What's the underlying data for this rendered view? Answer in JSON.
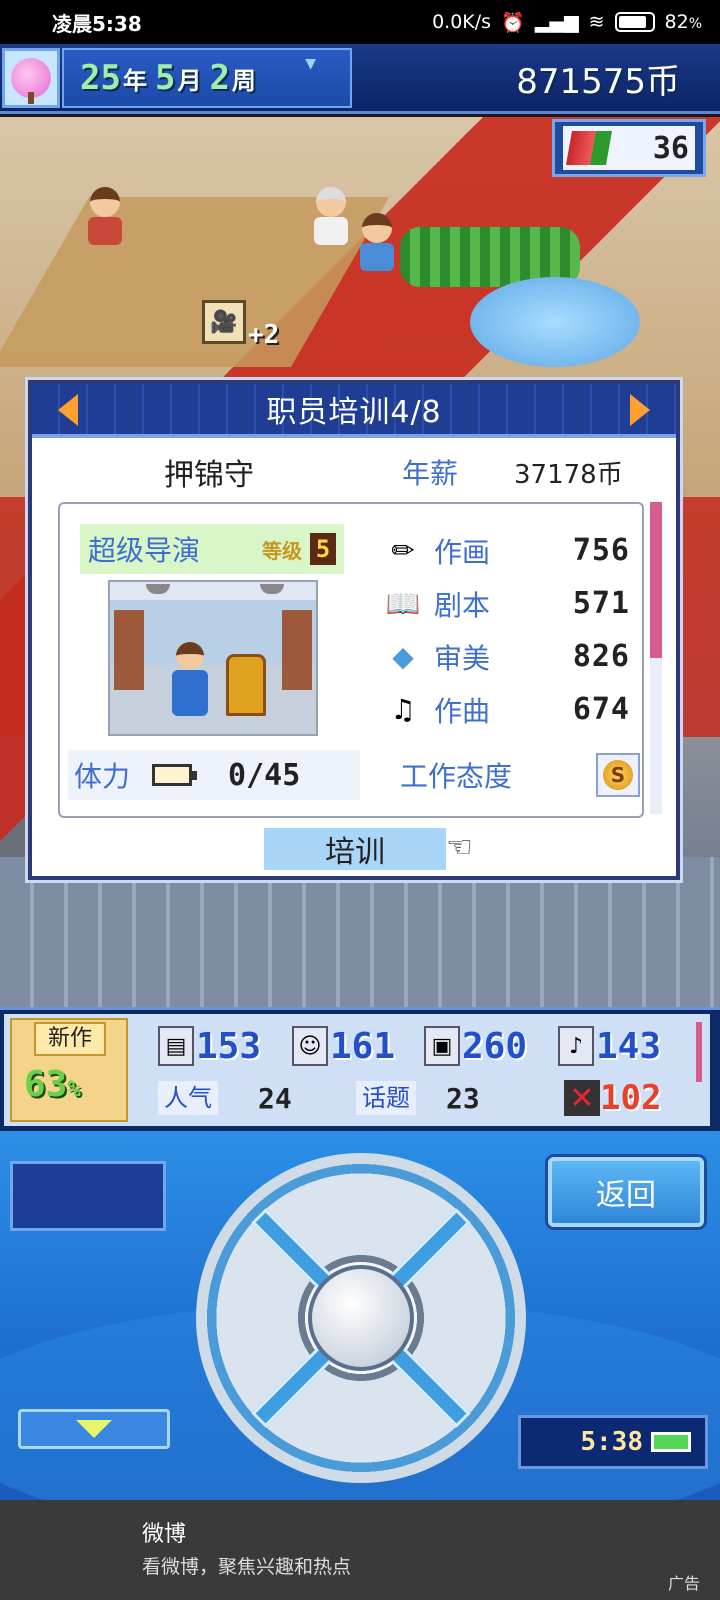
{
  "status_bar": {
    "time": "凌晨5:38",
    "network_speed": "0.0K/s",
    "battery": "82",
    "battery_unit": "%"
  },
  "top_bar": {
    "year": "25",
    "year_unit": "年",
    "month": "5",
    "month_unit": "月",
    "week": "2",
    "week_unit": "周",
    "money": "871575币",
    "fans_count": "36"
  },
  "scene": {
    "popup_gain": "+2"
  },
  "dialog": {
    "title": "职员培训4/8",
    "staff_name": "押锦守",
    "salary_label": "年薪",
    "salary_value": "37178币",
    "job": "超级导演",
    "level_label": "等级",
    "level_value": "5",
    "stamina_label": "体力",
    "stamina_value": "0/45",
    "stats": [
      {
        "icon": "pencil-icon",
        "label": "作画",
        "value": "756"
      },
      {
        "icon": "book-icon",
        "label": "剧本",
        "value": "571"
      },
      {
        "icon": "fan-icon",
        "label": "审美",
        "value": "826"
      },
      {
        "icon": "guitar-icon",
        "label": "作曲",
        "value": "674"
      }
    ],
    "attitude_label": "工作态度",
    "attitude_value": "S",
    "train_button": "培训"
  },
  "project_bar": {
    "new_work_label": "新作",
    "progress": "63",
    "progress_unit": "%",
    "scenario": "153",
    "cast": "161",
    "direction": "260",
    "music": "143",
    "popularity_label": "人气",
    "popularity_value": "24",
    "topic_label": "话题",
    "topic_value": "23",
    "bugs": "102"
  },
  "controller": {
    "back_button": "返回",
    "clock": "5:38"
  },
  "ad": {
    "title": "微博",
    "subtitle": "看微博，聚焦兴趣和热点",
    "tag": "广告"
  },
  "colors": {
    "accent_blue": "#3f6fcf",
    "header_navy": "#1e3d93",
    "arrow_orange": "#ffa030"
  }
}
